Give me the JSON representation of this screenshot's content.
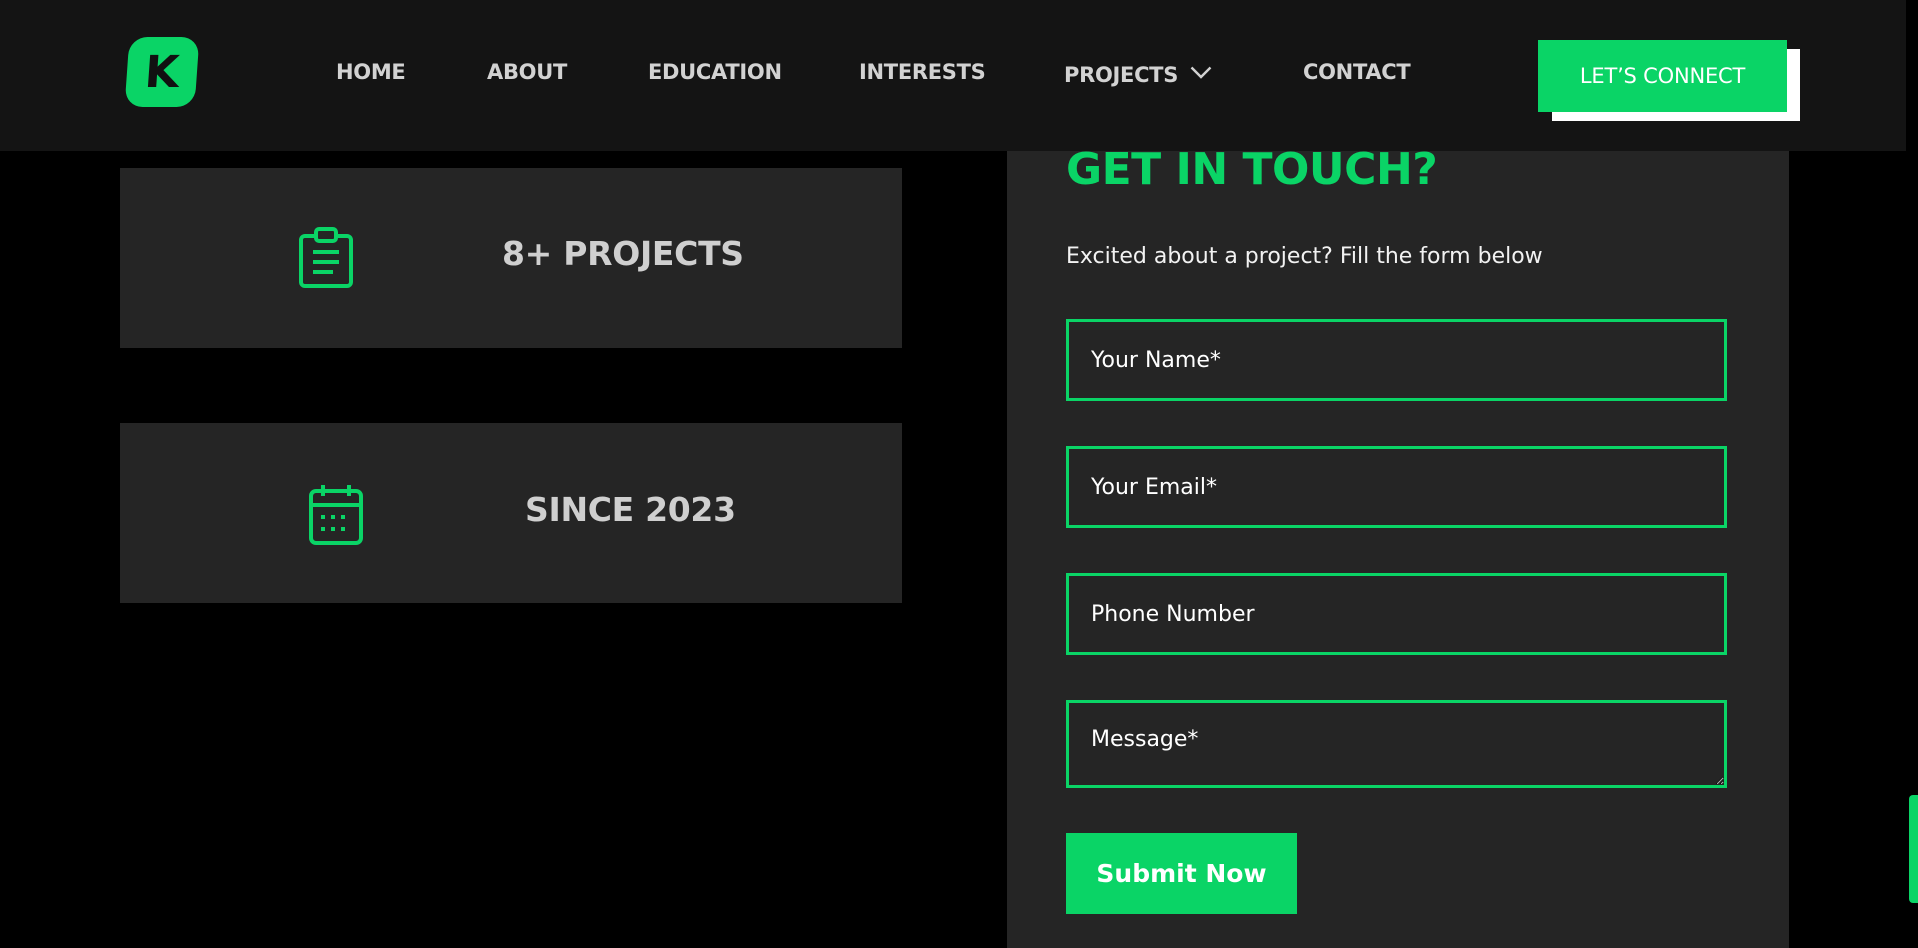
{
  "brand": {
    "logo_letter": "K",
    "accent_color": "#0ad466"
  },
  "nav": {
    "items": [
      {
        "label": "HOME"
      },
      {
        "label": "ABOUT"
      },
      {
        "label": "EDUCATION"
      },
      {
        "label": "INTERESTS"
      },
      {
        "label": "PROJECTS",
        "has_dropdown": true,
        "icon": "chevron-down-icon"
      },
      {
        "label": "CONTACT"
      }
    ],
    "cta_label": "LET’S CONNECT"
  },
  "stats": [
    {
      "icon": "clipboard-icon",
      "label": "8+ PROJECTS"
    },
    {
      "icon": "calendar-icon",
      "label": "SINCE 2023"
    }
  ],
  "contact": {
    "title": "GET IN TOUCH?",
    "subtitle": "Excited about a project? Fill the form below",
    "fields": {
      "name_placeholder": "Your Name*",
      "email_placeholder": "Your Email*",
      "phone_placeholder": "Phone Number",
      "message_placeholder": "Message*"
    },
    "submit_label": "Submit Now"
  }
}
